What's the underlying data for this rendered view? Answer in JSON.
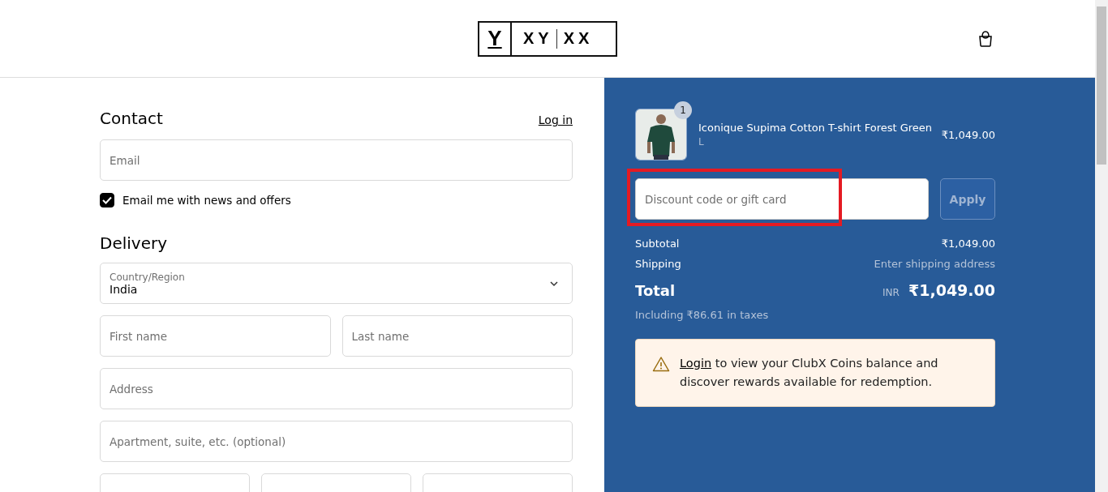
{
  "header": {
    "logo": {
      "mark": "Y",
      "left": "XY",
      "right": "XX"
    }
  },
  "contact": {
    "title": "Contact",
    "login_link": "Log in",
    "email": {
      "placeholder": "Email"
    },
    "newsletter": {
      "label": "Email me with news and offers",
      "checked": true
    }
  },
  "delivery": {
    "title": "Delivery",
    "country": {
      "label": "Country/Region",
      "value": "India"
    },
    "fields": [
      {
        "placeholder": "First name",
        "kind": "half"
      },
      {
        "placeholder": "Last name",
        "kind": "half"
      },
      {
        "placeholder": "Address",
        "kind": "full"
      },
      {
        "placeholder": "Apartment, suite, etc. (optional)",
        "kind": "full"
      }
    ]
  },
  "summary": {
    "items": [
      {
        "name": "Iconique Supima Cotton T-shirt Forest Green",
        "variant": "L",
        "quantity": "1",
        "price": "₹1,049.00"
      }
    ],
    "discount": {
      "placeholder": "Discount code or gift card",
      "button": "Apply",
      "highlighted": true
    },
    "lines": [
      {
        "label": "Subtotal",
        "value": "₹1,049.00",
        "muted": false
      },
      {
        "label": "Shipping",
        "value": "Enter shipping address",
        "muted": true
      }
    ],
    "total": {
      "label": "Total",
      "currency": "INR",
      "value": "₹1,049.00"
    },
    "taxes": "Including ₹86.61 in taxes",
    "notice": {
      "link": "Login",
      "text": " to view your ClubX Coins balance and discover rewards available for redemption."
    }
  }
}
